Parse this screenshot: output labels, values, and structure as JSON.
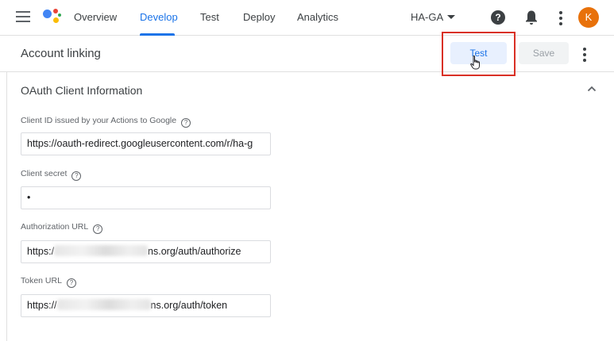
{
  "topbar": {
    "tabs": [
      {
        "label": "Overview",
        "active": false
      },
      {
        "label": "Develop",
        "active": true
      },
      {
        "label": "Test",
        "active": false
      },
      {
        "label": "Deploy",
        "active": false
      },
      {
        "label": "Analytics",
        "active": false
      }
    ],
    "project_name": "HA-GA",
    "avatar_initial": "K",
    "help_glyph": "?",
    "accent_color": "#1a73e8",
    "avatar_color": "#e8710a"
  },
  "header": {
    "title": "Account linking",
    "test_label": "Test",
    "save_label": "Save"
  },
  "oauth": {
    "section_title": "OAuth Client Information",
    "fields": [
      {
        "label": "Client ID issued by your Actions to Google",
        "value": "https://oauth-redirect.googleusercontent.com/r/ha-g"
      },
      {
        "label": "Client secret",
        "value": "•"
      },
      {
        "label": "Authorization URL",
        "value_prefix": "https:/",
        "value_suffix": "ns.org/auth/authorize"
      },
      {
        "label": "Token URL",
        "value_prefix": "https://",
        "value_suffix": "ns.org/auth/token"
      }
    ]
  },
  "icons": {
    "menu": "menu-icon",
    "logo": "google-assistant-logo",
    "help": "help-icon",
    "notifications": "bell-icon",
    "more": "more-vert-icon",
    "collapse": "chevron-up-icon",
    "field_help": "help-outline-icon"
  }
}
